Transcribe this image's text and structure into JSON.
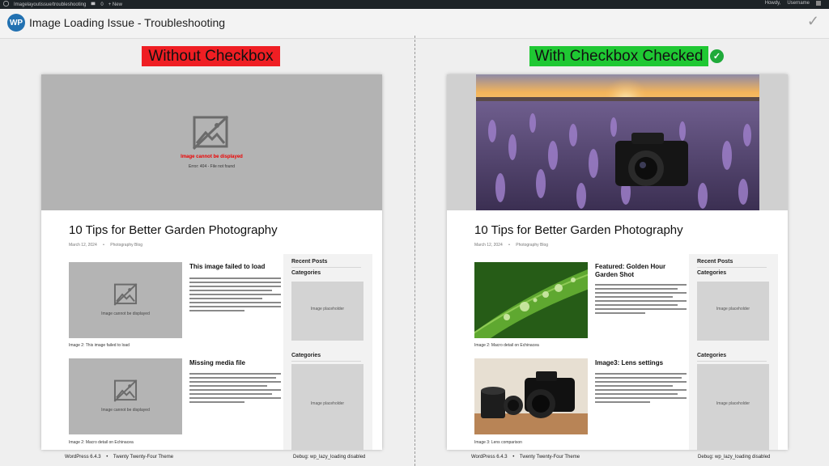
{
  "admin_bar": {
    "site": "Imagelayoutissue/troubleshooting",
    "comments": "0",
    "new_label": "+ New",
    "right_1": "Howdy,",
    "right_2": "Username"
  },
  "header": {
    "logo": "WP",
    "title": "Image Loading Issue - Troubleshooting",
    "check_icon": "✓"
  },
  "labels": {
    "left": "Without Checkbox",
    "right": "With Checkbox Checked",
    "check_icon": "✓"
  },
  "left_panel": {
    "hero_error": "Image cannot be displayed",
    "hero_error_detail": "Error: 404 - File not found",
    "post_title": "10 Tips for Better Garden Photography",
    "meta_date": "March 12, 2024",
    "meta_category": "Photography Blog",
    "items": [
      {
        "placeholder": "Image cannot be displayed",
        "caption": "Image 2: This image failed to load",
        "title": "This image failed to load"
      },
      {
        "placeholder": "Image cannot be displayed",
        "caption": "Image 2: Macro detail on Echinacea",
        "title": "Missing media file"
      }
    ],
    "sidebar": {
      "recent_posts": "Recent Posts",
      "categories_1": "Categories",
      "placeholder_1": "Image placeholder",
      "categories_2": "Categories",
      "placeholder_2": "Image placeholder"
    },
    "footer_version": "WordPress 6.4.3",
    "footer_sep": "•",
    "footer_theme": "Twenty Twenty-Four Theme",
    "footer_debug": "Debug: wp_lazy_loading disabled"
  },
  "right_panel": {
    "post_title": "10 Tips for Better Garden Photography",
    "meta_date": "March 12, 2024",
    "meta_category": "Photography Blog",
    "items": [
      {
        "caption": "Image 2: Macro detail on Echinacea",
        "title": "Featured: Golden Hour Garden Shot"
      },
      {
        "caption": "Image 3: Lens comparison",
        "title": "Image3: Lens settings"
      }
    ],
    "sidebar": {
      "recent_posts": "Recent Posts",
      "categories_1": "Categories",
      "placeholder_1": "Image placeholder",
      "categories_2": "Categories",
      "placeholder_2": "Image placeholder"
    },
    "footer_version": "WordPress 6.4.3",
    "footer_sep": "•",
    "footer_theme": "Twenty Twenty-Four Theme",
    "footer_debug": "Debug: wp_lazy_loading disabled"
  },
  "colors": {
    "red_label": "#ef1e23",
    "green_label": "#1fc833",
    "error_text": "#e00000",
    "wp_blue": "#2271b1",
    "admin_bar": "#1d2327"
  },
  "icons": [
    "wordpress-logo-icon",
    "checkmark-icon",
    "check-circle-icon",
    "broken-image-icon",
    "comment-icon",
    "plus-icon"
  ]
}
